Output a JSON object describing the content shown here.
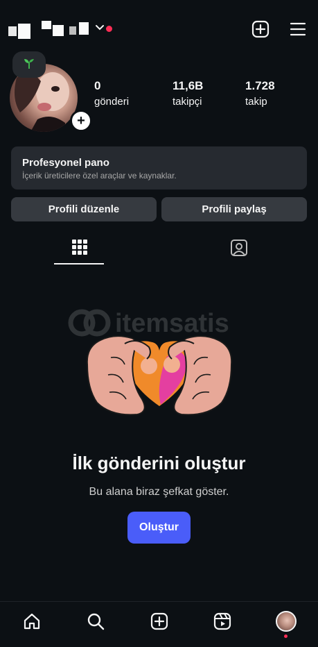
{
  "header": {
    "username_censored": true,
    "has_notification_dot": true,
    "icons": [
      "chevron-down-icon",
      "create-plus-icon",
      "menu-icon"
    ]
  },
  "profile": {
    "note_icon": "sprout-icon",
    "stats": [
      {
        "value": "0",
        "label": "gönderi"
      },
      {
        "value": "11,6B",
        "label": "takipçi"
      },
      {
        "value": "1.728",
        "label": "takip"
      }
    ]
  },
  "pro_dashboard": {
    "title": "Profesyonel pano",
    "subtitle": "İçerik üreticilere özel araçlar ve kaynaklar."
  },
  "actions": {
    "edit_profile": "Profili düzenle",
    "share_profile": "Profili paylaş"
  },
  "tabs": [
    {
      "icon": "grid-icon",
      "active": true
    },
    {
      "icon": "tagged-icon",
      "active": false
    }
  ],
  "watermark": {
    "text": "itemsatis"
  },
  "empty_state": {
    "title": "İlk gönderini oluştur",
    "subtitle": "Bu alana biraz şefkat göster.",
    "button": "Oluştur"
  },
  "bottom_nav": [
    "home-icon",
    "search-icon",
    "create-icon",
    "reels-icon",
    "profile-avatar"
  ],
  "colors": {
    "background": "#0c1014",
    "card": "#262a30",
    "button": "#363a40",
    "accent": "#4a5df9",
    "notification": "#ff2d55"
  }
}
